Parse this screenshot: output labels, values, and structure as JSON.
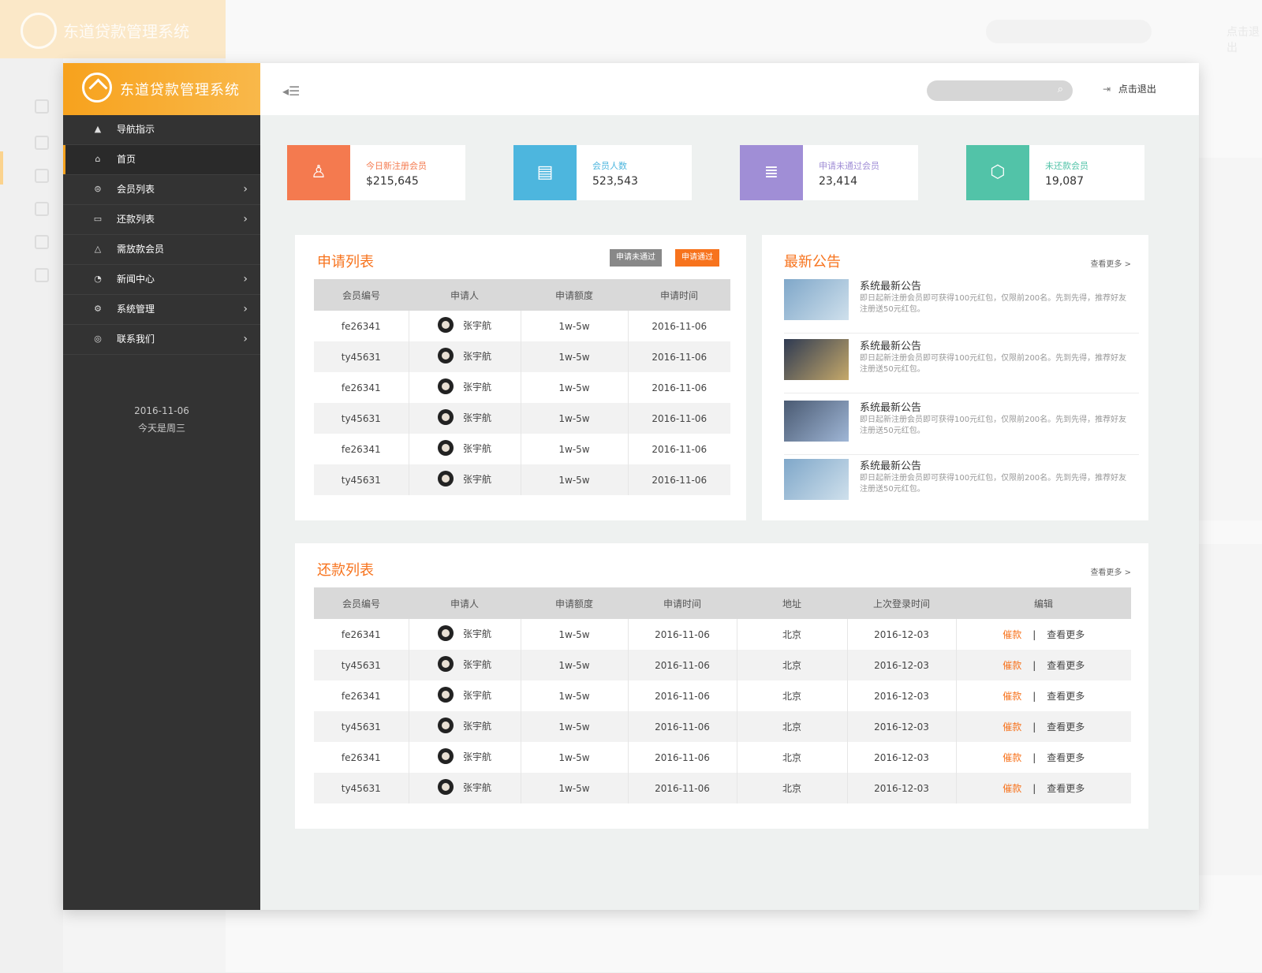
{
  "app": {
    "title": "东道贷款管理系统"
  },
  "topbar": {
    "logout": "点击退出"
  },
  "background": {
    "logout": "点击退出"
  },
  "sidebar": {
    "items": [
      {
        "label": "导航指示",
        "icon": "sitemap-icon"
      },
      {
        "label": "首页",
        "icon": "home-icon"
      },
      {
        "label": "会员列表",
        "icon": "list-icon"
      },
      {
        "label": "还款列表",
        "icon": "card-icon"
      },
      {
        "label": "需放款会员",
        "icon": "warning-icon"
      },
      {
        "label": "新闻中心",
        "icon": "megaphone-icon"
      },
      {
        "label": "系统管理",
        "icon": "gear-icon"
      },
      {
        "label": "联系我们",
        "icon": "contact-icon"
      }
    ],
    "date": "2016-11-06",
    "weekday": "今天是周三"
  },
  "stats": [
    {
      "label": "今日新注册会员",
      "value": "$215,645",
      "color": "#f47a4f"
    },
    {
      "label": "会员人数",
      "value": "523,543",
      "color": "#4db6de"
    },
    {
      "label": "申请未通过会员",
      "value": "23,414",
      "color": "#a08ed6"
    },
    {
      "label": "未还款会员",
      "value": "19,087",
      "color": "#52c3a8"
    }
  ],
  "applications": {
    "title": "申请列表",
    "btn_rejected": "申请未通过",
    "btn_approved": "申请通过",
    "headers": [
      "会员编号",
      "申请人",
      "申请额度",
      "申请时间"
    ],
    "rows": [
      [
        "fe26341",
        "张宇航",
        "1w-5w",
        "2016-11-06"
      ],
      [
        "ty45631",
        "张宇航",
        "1w-5w",
        "2016-11-06"
      ],
      [
        "fe26341",
        "张宇航",
        "1w-5w",
        "2016-11-06"
      ],
      [
        "ty45631",
        "张宇航",
        "1w-5w",
        "2016-11-06"
      ],
      [
        "fe26341",
        "张宇航",
        "1w-5w",
        "2016-11-06"
      ],
      [
        "ty45631",
        "张宇航",
        "1w-5w",
        "2016-11-06"
      ]
    ]
  },
  "announcements": {
    "title": "最新公告",
    "more": "查看更多 >",
    "items": [
      {
        "title": "系统最新公告",
        "body": "即日起新注册会员即可获得100元红包，仅限前200名。先到先得，推荐好友注册送50元红包。"
      },
      {
        "title": "系统最新公告",
        "body": "即日起新注册会员即可获得100元红包，仅限前200名。先到先得，推荐好友注册送50元红包。"
      },
      {
        "title": "系统最新公告",
        "body": "即日起新注册会员即可获得100元红包，仅限前200名。先到先得，推荐好友注册送50元红包。"
      },
      {
        "title": "系统最新公告",
        "body": "即日起新注册会员即可获得100元红包，仅限前200名。先到先得，推荐好友注册送50元红包。"
      }
    ]
  },
  "repayments": {
    "title": "还款列表",
    "more": "查看更多 >",
    "headers": [
      "会员编号",
      "申请人",
      "申请额度",
      "申请时间",
      "地址",
      "上次登录时间",
      "编辑"
    ],
    "action_urge": "催款",
    "action_more": "查看更多",
    "rows": [
      [
        "fe26341",
        "张宇航",
        "1w-5w",
        "2016-11-06",
        "北京",
        "2016-12-03"
      ],
      [
        "ty45631",
        "张宇航",
        "1w-5w",
        "2016-11-06",
        "北京",
        "2016-12-03"
      ],
      [
        "fe26341",
        "张宇航",
        "1w-5w",
        "2016-11-06",
        "北京",
        "2016-12-03"
      ],
      [
        "ty45631",
        "张宇航",
        "1w-5w",
        "2016-11-06",
        "北京",
        "2016-12-03"
      ],
      [
        "fe26341",
        "张宇航",
        "1w-5w",
        "2016-11-06",
        "北京",
        "2016-12-03"
      ],
      [
        "ty45631",
        "张宇航",
        "1w-5w",
        "2016-11-06",
        "北京",
        "2016-12-03"
      ]
    ]
  }
}
